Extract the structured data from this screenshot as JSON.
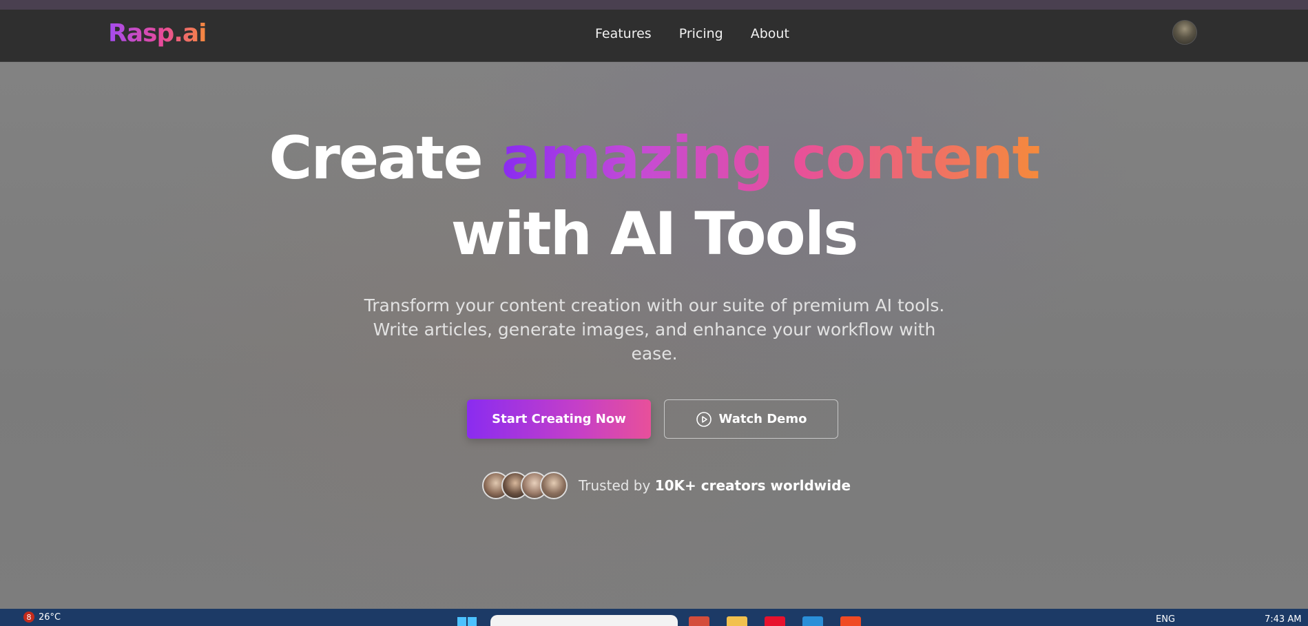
{
  "nav": {
    "logo": "Rasp.ai",
    "links": [
      "Features",
      "Pricing",
      "About"
    ]
  },
  "hero": {
    "headline_white_1": "Create ",
    "headline_gradient": "amazing content",
    "headline_line2": "with AI Tools",
    "subtitle": "Transform your content creation with our suite of premium AI tools. Write articles, generate images, and enhance your workflow with ease.",
    "primary_cta": "Start Creating Now",
    "secondary_cta": "Watch Demo",
    "trust_prefix": "Trusted by ",
    "trust_strong": "10K+ creators worldwide"
  },
  "taskbar": {
    "notification_count": "8",
    "temperature": "26°C",
    "language": "ENG",
    "time": "7:43 AM"
  },
  "colors": {
    "gradient_start": "#8a2cf0",
    "gradient_mid": "#e8509a",
    "gradient_end": "#f58a3c",
    "navbar_bg": "#2f2f2f",
    "taskbar_bg": "#1c3a66"
  }
}
